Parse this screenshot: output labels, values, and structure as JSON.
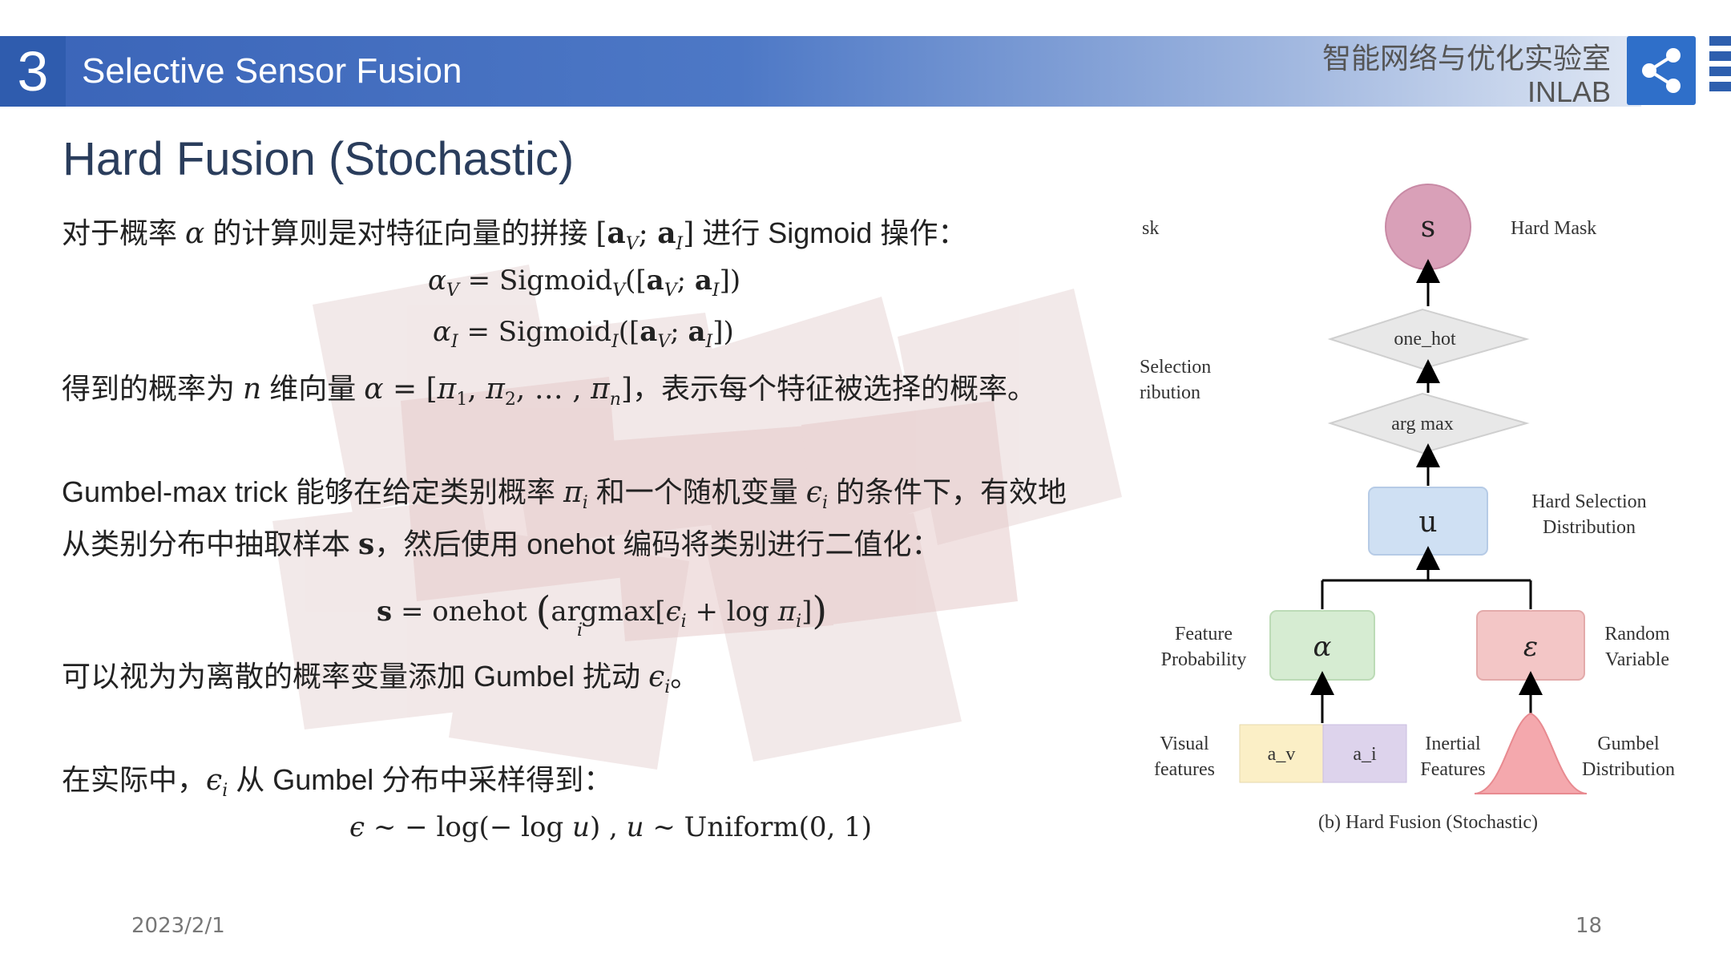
{
  "header": {
    "section_number": "3",
    "section_title": "Selective Sensor Fusion",
    "lab_name_cn": "智能网络与优化实验室",
    "lab_name_en": "INLAB"
  },
  "slide_title": "Hard Fusion (Stochastic)",
  "body": {
    "p1_a": "对于概率 ",
    "p1_b": " 的计算则是对特征向量的拼接 ",
    "p1_c": " 进行 Sigmoid 操作：",
    "eq1": "αV = SigmoidV([aV; aI])",
    "eq2": "αI = SigmoidI([aV; aI])",
    "p2_a": "得到的概率为 ",
    "p2_b": " 维向量 ",
    "p2_c": "，表示每个特征被选择的概率。",
    "p3_a": "Gumbel-max trick 能够在给定类别概率 ",
    "p3_b": " 和一个随机变量 ",
    "p3_c": " 的条件下，有效地",
    "p4_a": "从类别分布中抽取样本 ",
    "p4_b": "，然后使用 onehot 编码将类别进行二值化：",
    "eq3": "s = onehot (argmax[ϵi + log πi])",
    "p5_a": "可以视为为离散的概率变量添加 Gumbel 扰动 ",
    "p5_b": "。",
    "p6_a": "在实际中，",
    "p6_b": " 从 Gumbel 分布中采样得到：",
    "eq4": "ϵ ~ − log(− log u) , u ~ Uniform(0, 1)"
  },
  "diagram": {
    "node_s": "s",
    "node_onehot": "one_hot",
    "node_argmax": "arg max",
    "node_u": "u",
    "node_alpha": "α",
    "node_eps": "ε",
    "node_av": "a_v",
    "node_ai": "a_i",
    "label_hard_mask": "Hard Mask",
    "label_hsd_1": "Hard Selection",
    "label_hsd_2": "Distribution",
    "label_fp_1": "Feature",
    "label_fp_2": "Probability",
    "label_rv_1": "Random",
    "label_rv_2": "Variable",
    "label_vf_1": "Visual",
    "label_vf_2": "features",
    "label_if_1": "Inertial",
    "label_if_2": "Features",
    "label_gd_1": "Gumbel",
    "label_gd_2": "Distribution",
    "caption": "(b)  Hard Fusion   (Stochastic)",
    "cut_sk": "sk",
    "cut_sel": "Selection",
    "cut_dist": "ribution",
    "colors": {
      "s": "#d9a0b8",
      "u": "#cfe0f3",
      "alpha": "#d6ecd2",
      "eps": "#f3c6c6",
      "av": "#fbefc6",
      "ai": "#ddd3ec",
      "gumbel": "#f4a8ad"
    }
  },
  "footer": {
    "date": "2023/2/1",
    "page": "18"
  }
}
